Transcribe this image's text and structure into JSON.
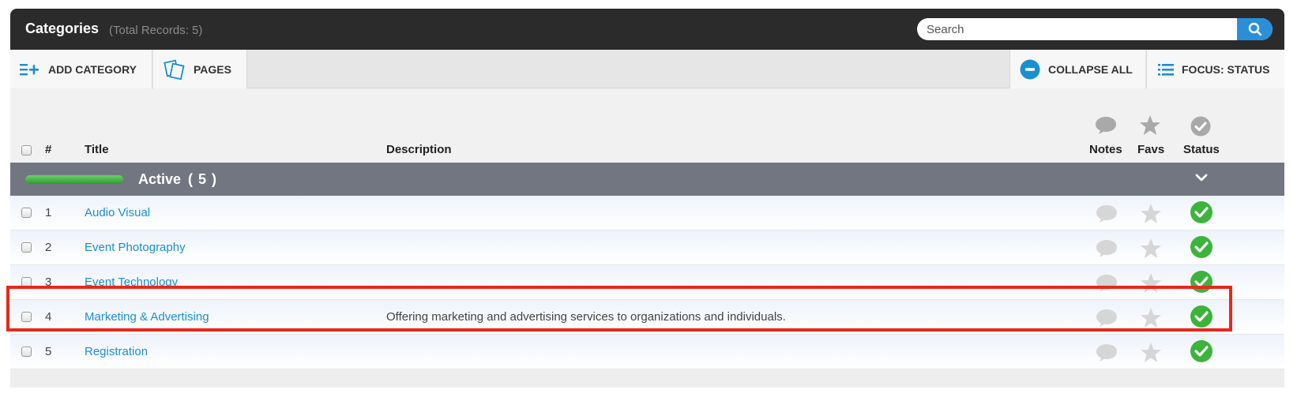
{
  "header": {
    "title": "Categories",
    "records": "(Total Records: 5)",
    "search_placeholder": "Search"
  },
  "toolbar": {
    "add_label": "ADD CATEGORY",
    "pages_label": "PAGES",
    "collapse_label": "COLLAPSE ALL",
    "focus_label": "FOCUS: STATUS"
  },
  "columns": {
    "number": "#",
    "title": "Title",
    "description": "Description",
    "notes": "Notes",
    "favs": "Favs",
    "status": "Status"
  },
  "group": {
    "title": "Active",
    "count": "( 5 )"
  },
  "rows": [
    {
      "num": "1",
      "title": "Audio Visual",
      "description": ""
    },
    {
      "num": "2",
      "title": "Event Photography",
      "description": ""
    },
    {
      "num": "3",
      "title": "Event Technology",
      "description": ""
    },
    {
      "num": "4",
      "title": "Marketing & Advertising",
      "description": "Offering marketing and advertising services to organizations and individuals."
    },
    {
      "num": "5",
      "title": "Registration",
      "description": ""
    }
  ],
  "colors": {
    "accent": "#1a8fd0",
    "status_active": "#3cb43c",
    "header_bg": "#2b2b2b",
    "group_bg": "#717680",
    "highlight": "#e8281c"
  },
  "icons": [
    "add-list-icon",
    "pages-icon",
    "collapse-icon",
    "list-icon",
    "search-icon",
    "comment-icon",
    "star-icon",
    "check-circle-icon",
    "chevron-down-icon"
  ]
}
